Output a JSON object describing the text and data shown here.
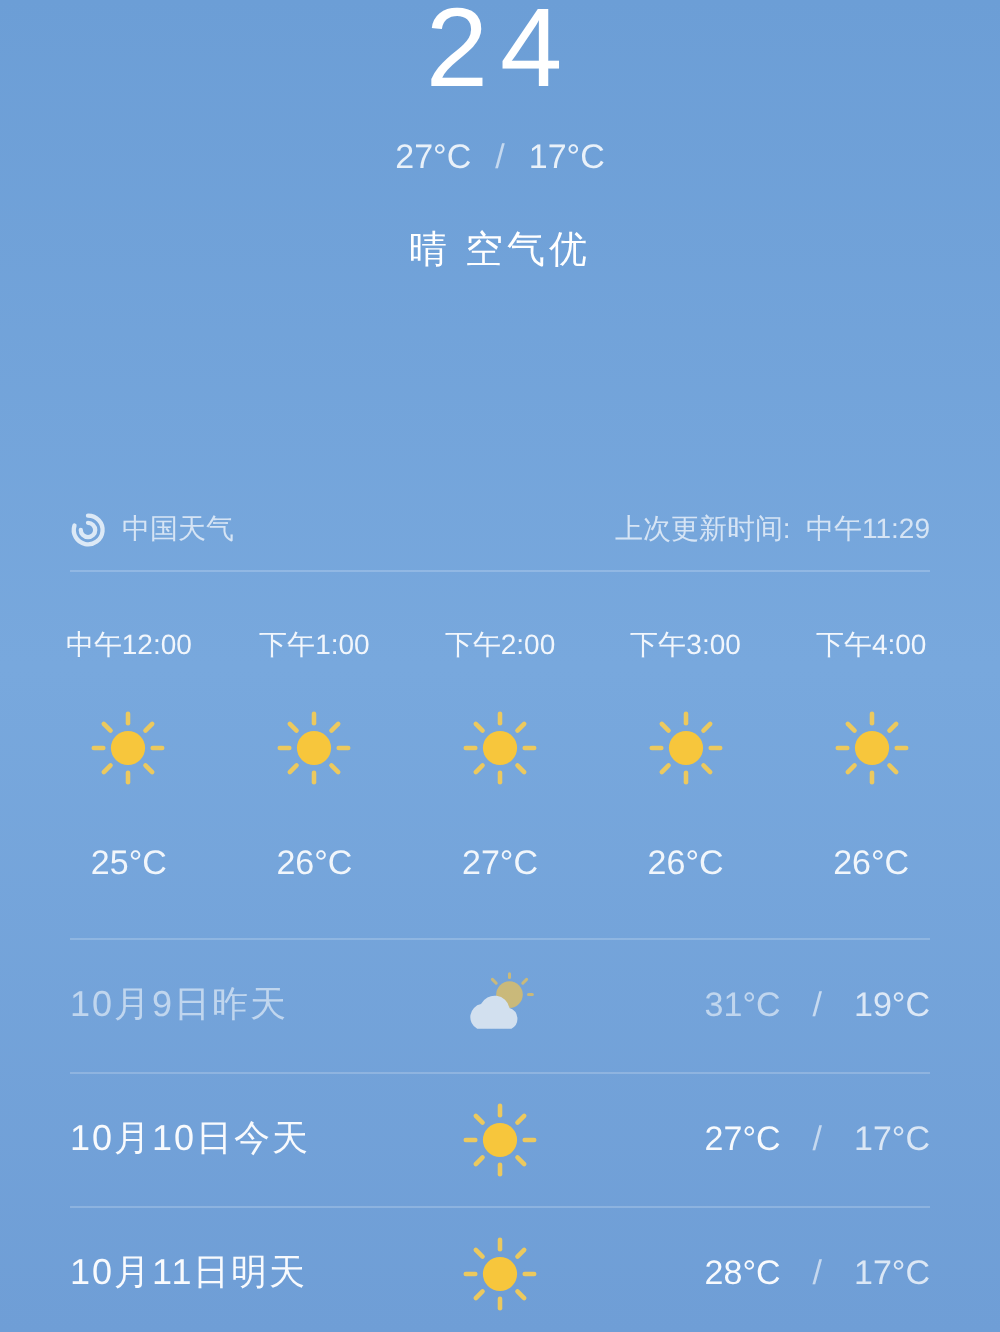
{
  "current": {
    "temperature": "24",
    "high_low": {
      "high": "27°C",
      "separator": "/",
      "low": "17°C"
    },
    "condition": "晴 空气优"
  },
  "source": {
    "name": "中国天气",
    "updated": "上次更新时间:  中午11:29"
  },
  "hourly": [
    {
      "time": "中午12:00",
      "kind": "sunny",
      "temp": "25°C"
    },
    {
      "time": "下午1:00",
      "kind": "sunny",
      "temp": "26°C"
    },
    {
      "time": "下午2:00",
      "kind": "sunny",
      "temp": "27°C"
    },
    {
      "time": "下午3:00",
      "kind": "sunny",
      "temp": "26°C"
    },
    {
      "time": "下午4:00",
      "kind": "sunny",
      "temp": "26°C"
    }
  ],
  "daily": [
    {
      "date": "10月9日昨天",
      "kind": "partly_cloudy",
      "high": "31°C",
      "separator": "/",
      "low": "19°C",
      "dimmed": true
    },
    {
      "date": "10月10日今天",
      "kind": "sunny",
      "high": "27°C",
      "separator": "/",
      "low": "17°C",
      "dimmed": false
    },
    {
      "date": "10月11日明天",
      "kind": "sunny",
      "high": "28°C",
      "separator": "/",
      "low": "17°C",
      "dimmed": false
    }
  ]
}
